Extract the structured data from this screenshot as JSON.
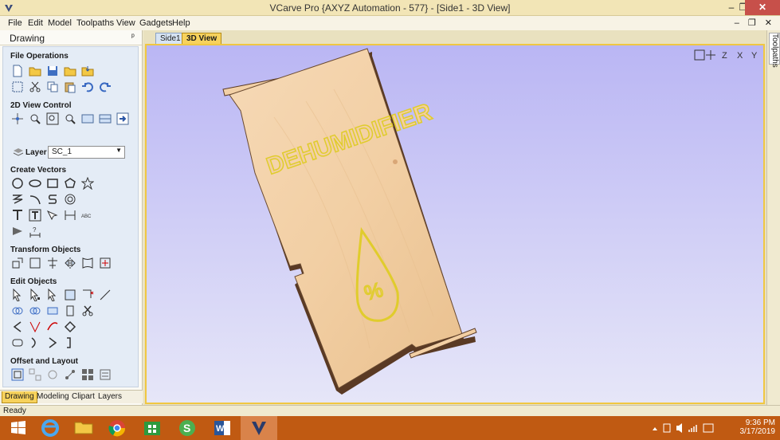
{
  "window": {
    "title": "VCarve Pro {AXYZ Automation - 577} - [Side1 - 3D View]",
    "min_label": "–",
    "max_label": "❐",
    "close_label": "✕"
  },
  "menu": {
    "items": [
      "File",
      "Edit",
      "Model",
      "Toolpaths",
      "View",
      "Gadgets",
      "Help"
    ],
    "mdi_controls": "– ❐ ✕"
  },
  "drawing_panel": {
    "title": "Drawing",
    "pin": "ᵖ",
    "sections": {
      "file_operations": "File Operations",
      "view_control": "2D View Control",
      "create_vectors": "Create Vectors",
      "transform_objects": "Transform Objects",
      "edit_objects": "Edit Objects",
      "offset_layout": "Offset and Layout"
    },
    "layer": {
      "label": "Layer",
      "value": "SC_1"
    },
    "bottom_tabs": [
      "Drawing",
      "Modeling",
      "Clipart",
      "Layers"
    ]
  },
  "view_tabs": [
    "Side1",
    "3D View"
  ],
  "right_strip": {
    "label": "Toolpaths"
  },
  "model": {
    "engraved_text": "DEHUMIDIFIER",
    "symbol_text": "%",
    "wood_color": "#f2cfa4",
    "engrave_color": "#f5e24a"
  },
  "view_toolbar_labels": [
    "Z",
    "X",
    "Y"
  ],
  "status": {
    "text": "Ready"
  },
  "taskbar": {
    "time": "9:36 PM",
    "date": "3/17/2019",
    "accent": "#c05a12"
  }
}
